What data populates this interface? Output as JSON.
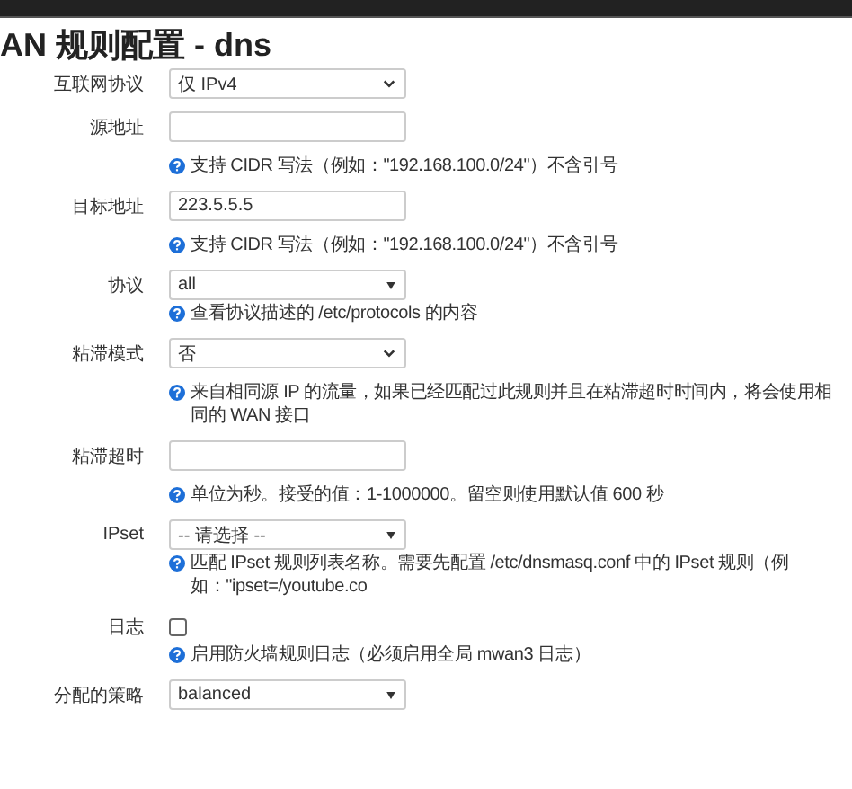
{
  "title": "AN 规则配置 - dns",
  "fields": [
    {
      "label": "互联网协议",
      "kind": "select",
      "value": "仅 IPv4"
    },
    {
      "label": "源地址",
      "kind": "input",
      "hint": "支持 CIDR 写法（例如：\"192.168.100.0/24\"）不含引号"
    },
    {
      "label": "目标地址",
      "kind": "input",
      "value": "223.5.5.5",
      "hint": "支持 CIDR 写法（例如：\"192.168.100.0/24\"）不含引号"
    },
    {
      "label": "协议",
      "kind": "dropdown",
      "value": "all",
      "hint": "查看协议描述的 /etc/protocols 的内容"
    },
    {
      "label": "粘滞模式",
      "kind": "select",
      "value": "否",
      "hint": "来自相同源 IP 的流量，如果已经匹配过此规则并且在粘滞超时时间内，将会使用相同的 WAN 接口"
    },
    {
      "label": "粘滞超时",
      "kind": "input",
      "hint": "单位为秒。接受的值：1-1000000。留空则使用默认值 600 秒"
    },
    {
      "label": "IPset",
      "kind": "dropdown",
      "value": "-- 请选择 --",
      "hint": "匹配 IPset 规则列表名称。需要先配置 /etc/dnsmasq.conf 中的 IPset 规则（例如：\"ipset=/youtube.co"
    },
    {
      "label": "日志",
      "kind": "checkbox",
      "checked": false,
      "hint": "启用防火墙规则日志（必须启用全局 mwan3 日志）"
    },
    {
      "label": "分配的策略",
      "kind": "dropdown",
      "value": "balanced"
    }
  ]
}
